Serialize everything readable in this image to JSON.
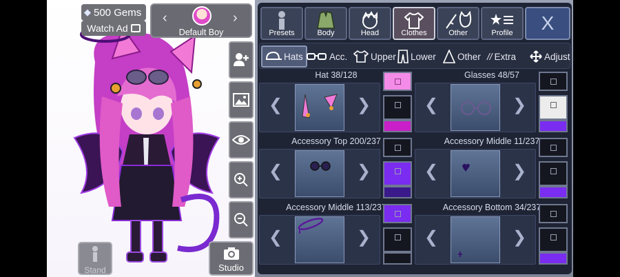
{
  "stage": {
    "gems_label": "500 Gems",
    "watch_label": "Watch Ad",
    "character_name": "Default Boy",
    "stand_label": "Stand",
    "studio_label": "Studio"
  },
  "categories": [
    {
      "label": "Presets"
    },
    {
      "label": "Body"
    },
    {
      "label": "Head"
    },
    {
      "label": "Clothes"
    },
    {
      "label": "Other"
    },
    {
      "label": "Profile"
    }
  ],
  "close_label": "X",
  "subtabs": [
    {
      "label": "Hats"
    },
    {
      "label": "Acc."
    },
    {
      "label": "Upper"
    },
    {
      "label": "Lower"
    },
    {
      "label": "Other"
    },
    {
      "label": "Extra"
    },
    {
      "label": "Adjust"
    }
  ],
  "slots": [
    {
      "title": "Hat 38/128"
    },
    {
      "title": "Glasses 48/57"
    },
    {
      "title": "Accessory Top 200/237"
    },
    {
      "title": "Accessory Middle 11/237"
    },
    {
      "title": "Accessory Middle 113/237"
    },
    {
      "title": "Accessory Bottom 34/237"
    }
  ],
  "colors": {
    "panel_bg": "#1e2434",
    "pink": "#f48be8",
    "magenta": "#c81fc8",
    "purple": "#7a2cf0",
    "dark": "#151720",
    "white": "#ececec"
  },
  "icons": {
    "gem": "gem-icon",
    "film": "film-icon",
    "add_user": "add-user-icon",
    "image": "image-icon",
    "eye": "eye-icon",
    "zoom_in": "zoom-in-icon",
    "zoom_out": "zoom-out-icon",
    "camera": "camera-icon"
  }
}
